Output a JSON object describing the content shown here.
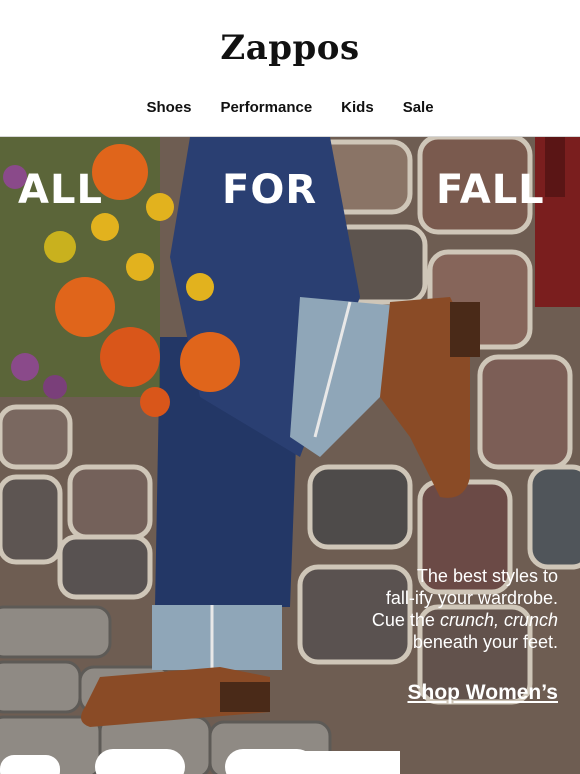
{
  "brand": {
    "name": "Zappos"
  },
  "nav": [
    {
      "label": "Shoes"
    },
    {
      "label": "Performance"
    },
    {
      "label": "Kids"
    },
    {
      "label": "Sale"
    }
  ],
  "hero": {
    "headline": {
      "word1": "ALL",
      "word2": "FOR",
      "word3": "FALL"
    },
    "copy": {
      "line1": "The best styles to",
      "line2": "fall-ify your wardrobe.",
      "line3_prefix": "Cue the ",
      "line3_emphasis": "crunch, crunch",
      "line4": "beneath your feet."
    },
    "cta_label": "Shop Women’s"
  },
  "colors": {
    "background": "#ffffff",
    "text": "#111111",
    "hero_text": "#ffffff",
    "denim": "#24386a",
    "boot": "#8a4b26",
    "marigold": "#e0651b"
  }
}
